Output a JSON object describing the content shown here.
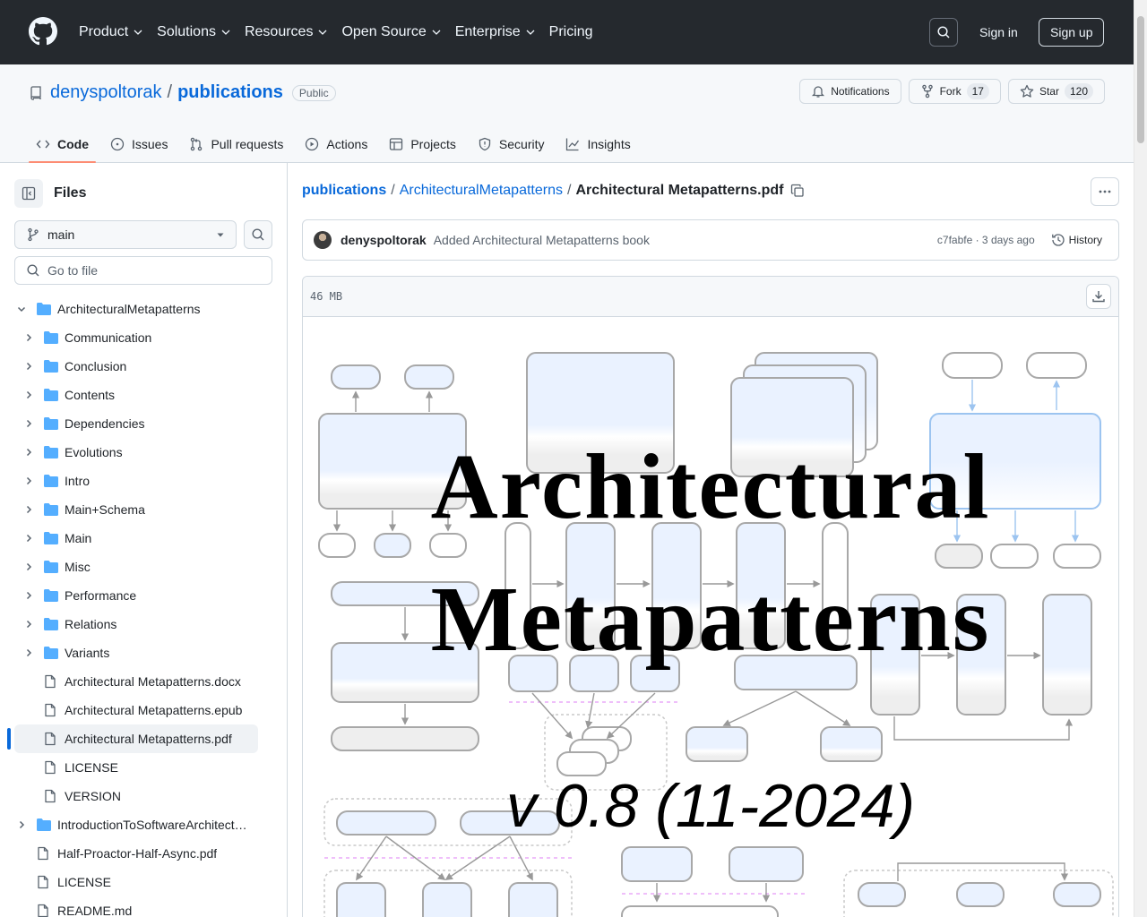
{
  "nav": {
    "items": [
      "Product",
      "Solutions",
      "Resources",
      "Open Source",
      "Enterprise",
      "Pricing"
    ],
    "sign_in": "Sign in",
    "sign_up": "Sign up"
  },
  "repo": {
    "owner": "denyspoltorak",
    "name": "publications",
    "visibility": "Public",
    "notifications_label": "Notifications",
    "fork_label": "Fork",
    "fork_count": "17",
    "star_label": "Star",
    "star_count": "120"
  },
  "tabs": [
    "Code",
    "Issues",
    "Pull requests",
    "Actions",
    "Projects",
    "Security",
    "Insights"
  ],
  "sidebar": {
    "title": "Files",
    "branch": "main",
    "goto_placeholder": "Go to file",
    "tree": [
      {
        "label": "ArchitecturalMetapatterns",
        "type": "folder",
        "expanded": true,
        "depth": 0
      },
      {
        "label": "Communication",
        "type": "folder",
        "depth": 1
      },
      {
        "label": "Conclusion",
        "type": "folder",
        "depth": 1
      },
      {
        "label": "Contents",
        "type": "folder",
        "depth": 1
      },
      {
        "label": "Dependencies",
        "type": "folder",
        "depth": 1
      },
      {
        "label": "Evolutions",
        "type": "folder",
        "depth": 1
      },
      {
        "label": "Intro",
        "type": "folder",
        "depth": 1
      },
      {
        "label": "Main+Schema",
        "type": "folder",
        "depth": 1
      },
      {
        "label": "Main",
        "type": "folder",
        "depth": 1
      },
      {
        "label": "Misc",
        "type": "folder",
        "depth": 1
      },
      {
        "label": "Performance",
        "type": "folder",
        "depth": 1
      },
      {
        "label": "Relations",
        "type": "folder",
        "depth": 1
      },
      {
        "label": "Variants",
        "type": "folder",
        "depth": 1
      },
      {
        "label": "Architectural Metapatterns.docx",
        "type": "file",
        "depth": 1
      },
      {
        "label": "Architectural Metapatterns.epub",
        "type": "file",
        "depth": 1
      },
      {
        "label": "Architectural Metapatterns.pdf",
        "type": "file",
        "depth": 1,
        "selected": true
      },
      {
        "label": "LICENSE",
        "type": "file",
        "depth": 1
      },
      {
        "label": "VERSION",
        "type": "file",
        "depth": 1
      },
      {
        "label": "IntroductionToSoftwareArchitect…",
        "type": "folder",
        "depth": 0
      },
      {
        "label": "Half-Proactor-Half-Async.pdf",
        "type": "file",
        "depth": 0
      },
      {
        "label": "LICENSE",
        "type": "file",
        "depth": 0
      },
      {
        "label": "README.md",
        "type": "file",
        "depth": 0
      }
    ]
  },
  "breadcrumb": {
    "root": "publications",
    "folder": "ArchitecturalMetapatterns",
    "file": "Architectural Metapatterns.pdf"
  },
  "commit": {
    "author": "denyspoltorak",
    "message": "Added Architectural Metapatterns book",
    "meta": "c7fabfe · 3 days ago",
    "history_label": "History"
  },
  "file": {
    "size": "46 MB",
    "cover_line1": "Architectural",
    "cover_line2": "Metapatterns",
    "cover_version": "v 0.8 (11-2024)"
  },
  "colors": {
    "header_bg": "#25292e",
    "link": "#0969da",
    "tab_underline": "#fd8c73",
    "folder_icon": "#54aeff"
  }
}
